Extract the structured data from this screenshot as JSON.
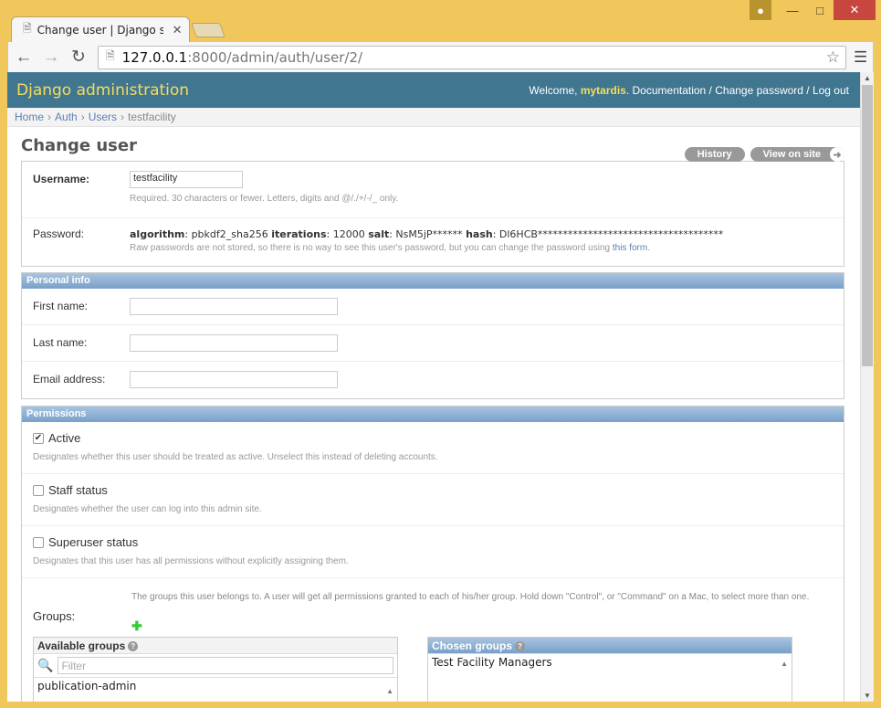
{
  "browser": {
    "tab_title": "Change user | Django site",
    "url_host": "127.0.0.1",
    "url_rest": ":8000/admin/auth/user/2/"
  },
  "header": {
    "brand": "Django administration",
    "welcome": "Welcome, ",
    "username": "mytardis",
    "links": ". Documentation / Change password / Log out"
  },
  "breadcrumbs": {
    "items": [
      "Home",
      "Auth",
      "Users"
    ],
    "current": "testfacility"
  },
  "page": {
    "title": "Change user",
    "history_label": "History",
    "view_on_site_label": "View on site"
  },
  "form": {
    "username_label": "Username:",
    "username_value": "testfacility",
    "username_help": "Required. 30 characters or fewer. Letters, digits and @/./+/-/_ only.",
    "password_label": "Password:",
    "pw_algorithm_key": "algorithm",
    "pw_algorithm_val": ": pbkdf2_sha256 ",
    "pw_iterations_key": "iterations",
    "pw_iterations_val": ": 12000 ",
    "pw_salt_key": "salt",
    "pw_salt_val": ": NsM5jP****** ",
    "pw_hash_key": "hash",
    "pw_hash_val": ": Dl6HCB*************************************",
    "pw_help": "Raw passwords are not stored, so there is no way to see this user's password, but you can change the password using ",
    "pw_help_link": "this form",
    "pw_help_end": "."
  },
  "personal_info": {
    "title": "Personal info",
    "first_name_label": "First name:",
    "last_name_label": "Last name:",
    "email_label": "Email address:"
  },
  "permissions": {
    "title": "Permissions",
    "active_label": "Active",
    "active_checked": true,
    "active_help": "Designates whether this user should be treated as active. Unselect this instead of deleting accounts.",
    "staff_label": "Staff status",
    "staff_help": "Designates whether the user can log into this admin site.",
    "superuser_label": "Superuser status",
    "superuser_help": "Designates that this user has all permissions without explicitly assigning them.",
    "groups_help": "The groups this user belongs to. A user will get all permissions granted to each of his/her group. Hold down \"Control\", or \"Command\" on a Mac, to select more than one.",
    "groups_label": "Groups:",
    "available_title": "Available groups",
    "filter_placeholder": "Filter",
    "available_items": [
      "publication-admin"
    ],
    "chosen_title": "Chosen groups",
    "chosen_items": [
      "Test Facility Managers"
    ]
  }
}
